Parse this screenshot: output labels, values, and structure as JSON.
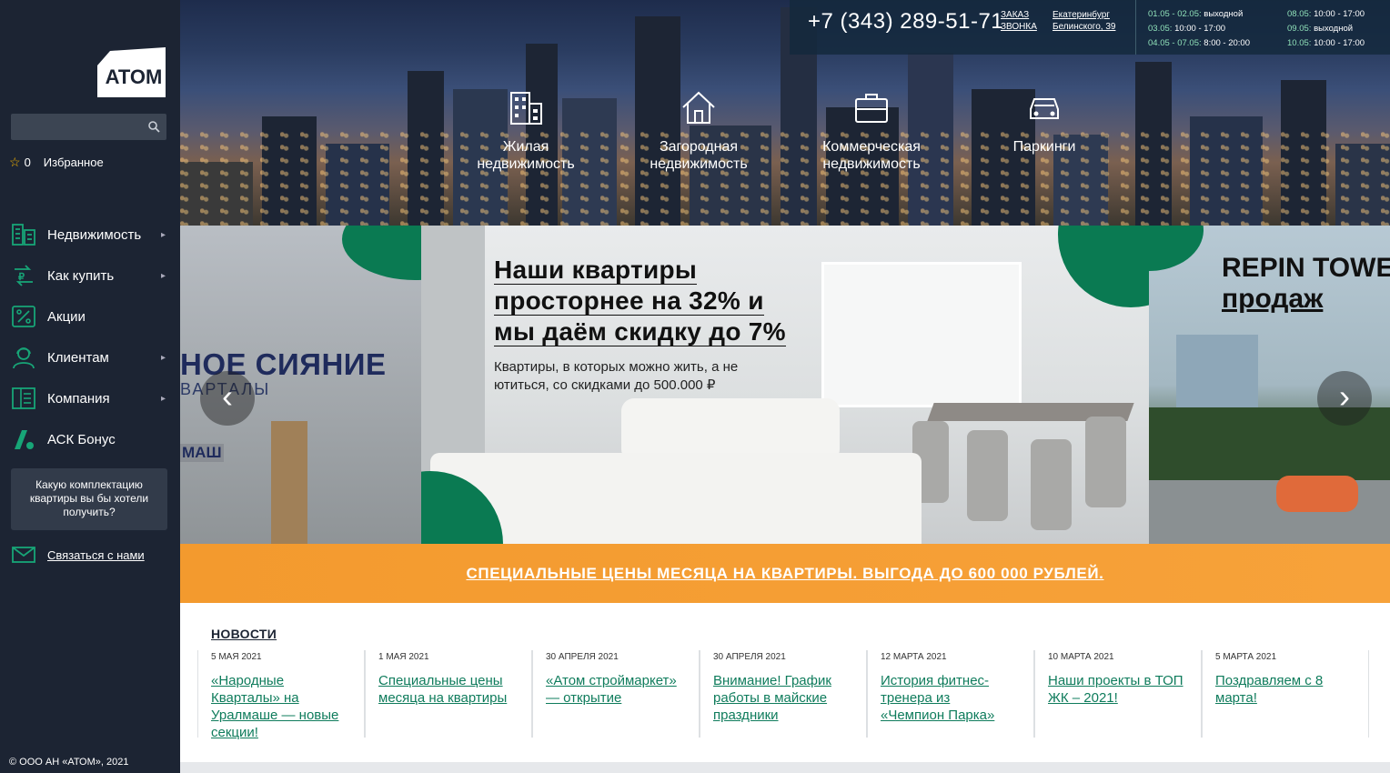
{
  "brand": {
    "logo_text": "ATOM"
  },
  "sidebar": {
    "favorites_count": "0",
    "favorites_label": "Избранное",
    "items": [
      {
        "label": "Недвижимость",
        "icon": "building-list-icon",
        "has_submenu": true
      },
      {
        "label": "Как купить",
        "icon": "ruble-exchange-icon",
        "has_submenu": true
      },
      {
        "label": "Акции",
        "icon": "percent-icon",
        "has_submenu": false
      },
      {
        "label": "Клиентам",
        "icon": "user-headset-icon",
        "has_submenu": true
      },
      {
        "label": "Компания",
        "icon": "company-icon",
        "has_submenu": true
      },
      {
        "label": "АСК Бонус",
        "icon": "ask-bonus-icon",
        "has_submenu": false
      }
    ],
    "quiz_text": "Какую комплектацию квартиры вы бы хотели получить?",
    "contact_label": "Связаться с нами",
    "copyright": "© ООО АН «АТОМ», 2021"
  },
  "header": {
    "phone": "+7 (343) 289-51-71",
    "callback_line1": "ЗАКАЗ",
    "callback_line2": "ЗВОНКА",
    "city": "Екатеринбург",
    "street": "Белинского, 39",
    "hours_left": [
      {
        "dates": "01.05 - 02.05:",
        "time": "выходной"
      },
      {
        "dates": "03.05:",
        "time": "10:00 - 17:00"
      },
      {
        "dates": "04.05 - 07.05:",
        "time": "8:00 - 20:00"
      }
    ],
    "hours_right": [
      {
        "dates": "08.05:",
        "time": "10:00 - 17:00"
      },
      {
        "dates": "09.05:",
        "time": "выходной"
      },
      {
        "dates": "10.05:",
        "time": "10:00 - 17:00"
      }
    ],
    "categories": [
      {
        "line1": "Жилая",
        "line2": "недвижимость",
        "icon": "apartment-building-icon"
      },
      {
        "line1": "Загородная",
        "line2": "недвижимость",
        "icon": "house-icon"
      },
      {
        "line1": "Коммерческая",
        "line2": "недвижимость",
        "icon": "briefcase-icon"
      },
      {
        "line1": "Паркинги",
        "line2": "",
        "icon": "car-icon"
      }
    ]
  },
  "carousel": {
    "left_slide": {
      "title": "НОЕ СИЯНИЕ",
      "subtitle": "ВАРТАЛЫ",
      "tag": "МАШ"
    },
    "main_slide": {
      "headline_lines": [
        "Наши квартиры",
        "просторнее на 32% и",
        "мы даём скидку до 7%"
      ],
      "subline": "Квартиры, в которых можно жить, а не ютиться, со скидками до 500.000 ₽"
    },
    "right_slide": {
      "line1": "REPIN TOWE",
      "line2": "продаж"
    },
    "prev_icon": "chevron-left-icon",
    "next_icon": "chevron-right-icon"
  },
  "banner": {
    "text": "СПЕЦИАЛЬНЫЕ ЦЕНЫ МЕСЯЦА НА КВАРТИРЫ. ВЫГОДА ДО 600 000 РУБЛЕЙ."
  },
  "news": {
    "title": "НОВОСТИ",
    "items": [
      {
        "date": "5 мая 2021",
        "title": "«Народные Кварталы» на Уралмаше — новые секции!"
      },
      {
        "date": "1 мая 2021",
        "title": "Специальные цены месяца на квартиры"
      },
      {
        "date": "30 апреля 2021",
        "title": "«Атом строймаркет» — открытие"
      },
      {
        "date": "30 апреля 2021",
        "title": "Внимание! График работы в майские праздники"
      },
      {
        "date": "12 марта 2021",
        "title": "История фитнес-тренера из «Чемпион Парка»"
      },
      {
        "date": "10 марта 2021",
        "title": "Наши проекты в ТОП ЖК – 2021!"
      },
      {
        "date": "5 марта 2021",
        "title": "Поздравляем с 8 марта!"
      }
    ]
  },
  "colors": {
    "sidebar_bg": "#1c2433",
    "accent_green": "#0a7a52",
    "link_green": "#0f7c5c",
    "banner_orange": "#f39a2e"
  }
}
